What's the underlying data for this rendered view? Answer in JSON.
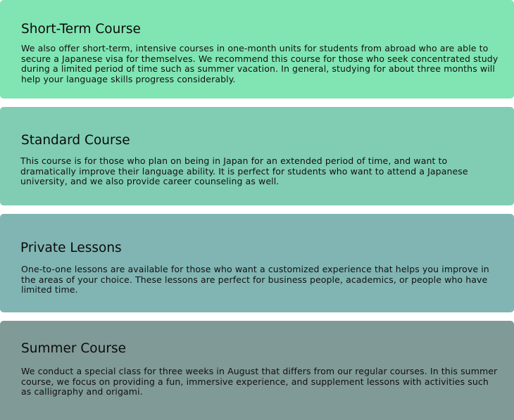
{
  "courses": [
    {
      "title": "Short-Term Course",
      "description": "We also offer short-term, intensive courses in one-month units for students from abroad who are able to secure a Japanese visa for themselves.  We recommend this course for those who seek concentrated study during a limited period of time such as summer vacation.  In general, studying for about three months will help your language skills progress considerably.",
      "color": "#80e5b3"
    },
    {
      "title": "Standard Course",
      "description": "This course is for those who plan on being in Japan for an extended period of time, and want to dramatically improve their language ability.  It is perfect for students who want to attend a Japanese university, and we also provide career counseling as well.",
      "color": "#80cdb3"
    },
    {
      "title": "Private Lessons",
      "description": "One-to-one lessons are available for those who want a customized experience that helps you improve in the areas of your choice.  These lessons are perfect for business people, academics, or people who have limited time.",
      "color": "#80b5b3"
    },
    {
      "title": "Summer Course",
      "description": "We conduct a special class for three weeks in August that differs from our regular courses.  In this summer course, we focus on providing a fun, immersive experience, and supplement lessons with activities such as calligraphy and origami.",
      "color": "#809a97"
    }
  ]
}
